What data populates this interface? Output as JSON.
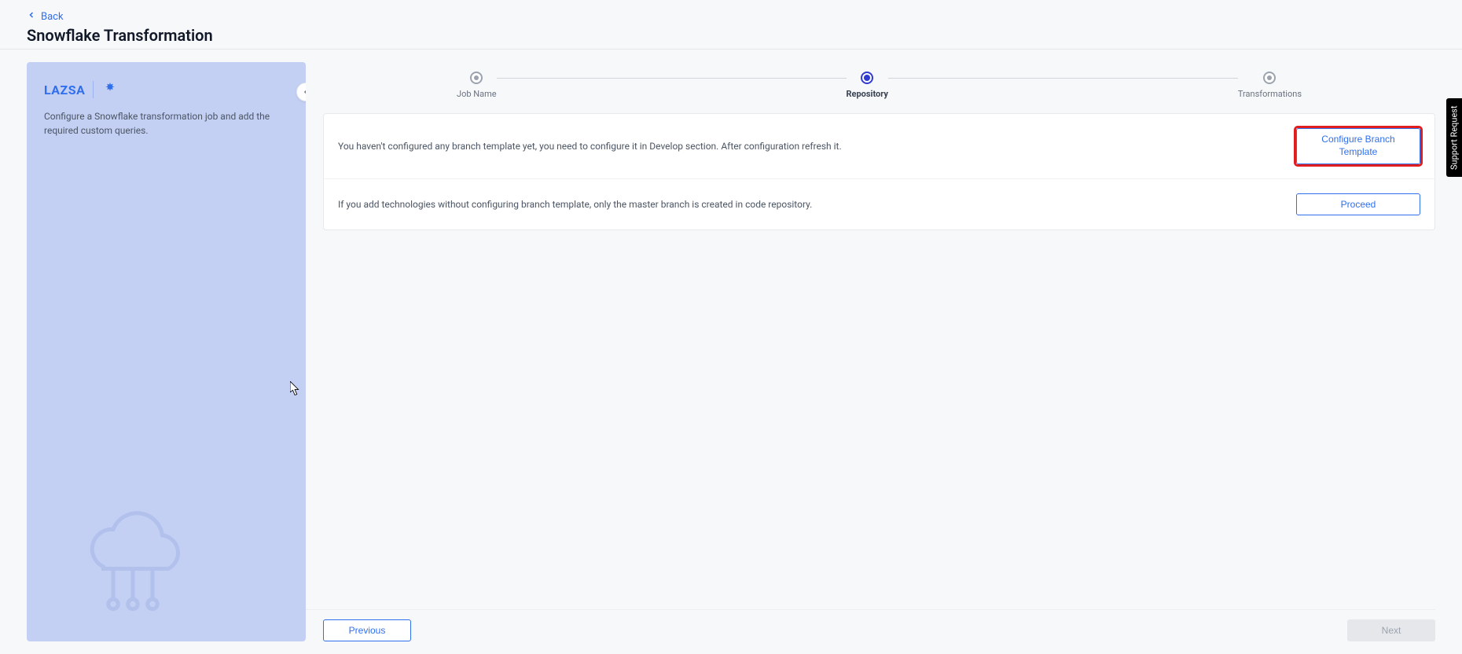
{
  "header": {
    "back_label": "Back",
    "title": "Snowflake Transformation"
  },
  "sidebar": {
    "logo_text": "LAZSA",
    "description": "Configure a Snowflake transformation job and add the required custom queries."
  },
  "stepper": {
    "step1": "Job Name",
    "step2": "Repository",
    "step3": "Transformations"
  },
  "card": {
    "row1_text": "You haven't configured any branch template yet, you need to configure it in Develop section. After configuration refresh it.",
    "row1_button": "Configure Branch Template",
    "row2_text": "If you add technologies without configuring branch template, only the master branch is created in code repository.",
    "row2_button": "Proceed"
  },
  "footer": {
    "previous": "Previous",
    "next": "Next"
  },
  "support": {
    "label": "Support Request"
  }
}
